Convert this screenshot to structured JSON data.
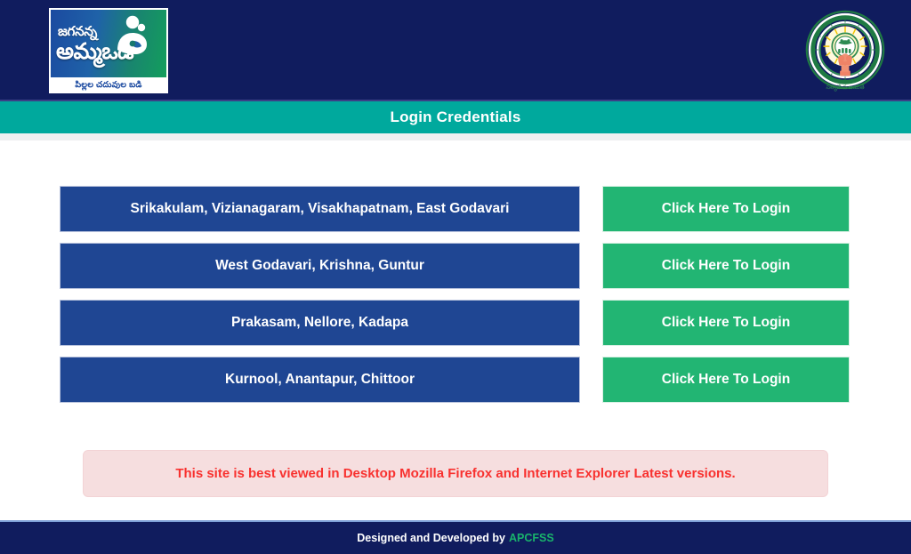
{
  "header": {
    "logo": {
      "line1": "జగనన్న",
      "line2": "అమ్మఒడి",
      "caption": "పిల్లల చదువుల బడి",
      "mark_icon": "mother-and-child-icon"
    },
    "emblem": {
      "icon": "andhra-pradesh-government-emblem-icon",
      "top_text": "ఆంధ్రప్రదేశ్ ప్రభుత్వం",
      "bottom_text": "సత్యమేవ జయతే"
    },
    "background_color": "#101c5e"
  },
  "titlebar": {
    "title": "Login Credentials",
    "background_color": "#00a99d"
  },
  "main": {
    "rows": [
      {
        "districts": "Srikakulam, Vizianagaram, Visakhapatnam, East Godavari",
        "login_label": "Click Here To Login"
      },
      {
        "districts": "West Godavari, Krishna, Guntur",
        "login_label": "Click Here To Login"
      },
      {
        "districts": "Prakasam, Nellore, Kadapa",
        "login_label": "Click Here To Login"
      },
      {
        "districts": "Kurnool, Anantapur, Chittoor",
        "login_label": "Click Here To Login"
      }
    ],
    "district_button_color": "#1f4693",
    "login_button_color": "#22b573",
    "notice": "This site is best viewed in Desktop Mozilla Firefox and Internet Explorer Latest versions.",
    "notice_text_color": "#f8312f",
    "notice_background_color": "#f6dedf"
  },
  "footer": {
    "text": "Designed and Developed by",
    "link_label": "APCFSS",
    "link_color": "#19b36b",
    "background_color": "#101c5e"
  }
}
